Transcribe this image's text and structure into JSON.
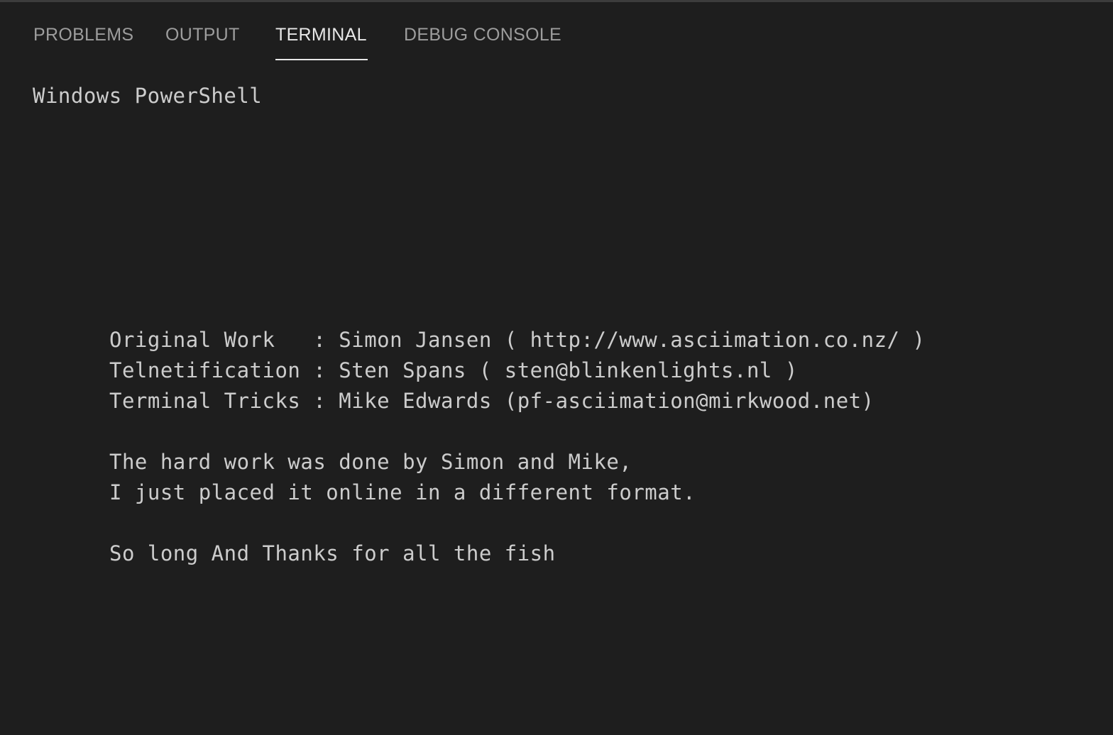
{
  "panel": {
    "tabs": [
      {
        "label": "PROBLEMS"
      },
      {
        "label": "OUTPUT"
      },
      {
        "label": "TERMINAL",
        "active": true
      },
      {
        "label": "DEBUG CONSOLE"
      }
    ]
  },
  "terminal": {
    "header": "Windows PowerShell",
    "credits": [
      "Original Work   : Simon Jansen ( http://www.asciimation.co.nz/ )",
      "Telnetification : Sten Spans ( sten@blinkenlights.nl )",
      "Terminal Tricks : Mike Edwards (pf-asciimation@mirkwood.net)"
    ],
    "note": [
      "The hard work was done by Simon and Mike,",
      "I just placed it online in a different format."
    ],
    "farewell": "So long And Thanks for all the fish"
  },
  "colors": {
    "background": "#1e1e1e",
    "tab_inactive": "#9d9d9d",
    "tab_active": "#e7e7e7",
    "terminal_text": "#cccccc"
  }
}
